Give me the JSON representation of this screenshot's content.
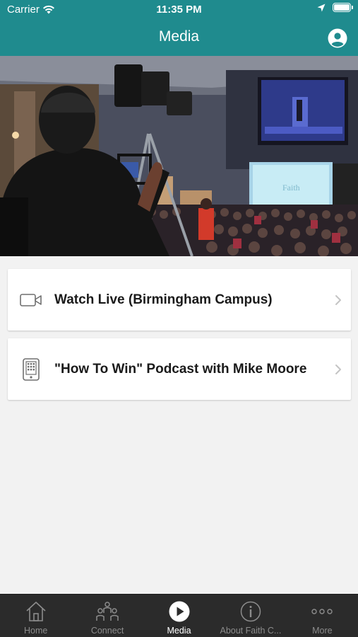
{
  "status_bar": {
    "carrier": "Carrier",
    "time": "11:35 PM"
  },
  "header": {
    "title": "Media",
    "background_color": "#1f8b8e"
  },
  "hero": {
    "description_icon": "camera-operator-photo"
  },
  "menu": {
    "items": [
      {
        "label": "Watch Live (Birmingham Campus)",
        "icon": "video-camera-icon"
      },
      {
        "label": "\"How To Win\" Podcast with Mike Moore",
        "icon": "tablet-icon"
      }
    ]
  },
  "tabbar": {
    "tabs": [
      {
        "label": "Home",
        "icon": "home-icon",
        "active": false
      },
      {
        "label": "Connect",
        "icon": "people-icon",
        "active": false
      },
      {
        "label": "Media",
        "icon": "play-icon",
        "active": true
      },
      {
        "label": "About Faith C...",
        "icon": "info-icon",
        "active": false
      },
      {
        "label": "More",
        "icon": "more-dots-icon",
        "active": false
      }
    ]
  },
  "colors": {
    "accent": "#1f8b8e",
    "tabbar_bg": "#2b2b2b",
    "page_bg": "#f2f2f2"
  }
}
